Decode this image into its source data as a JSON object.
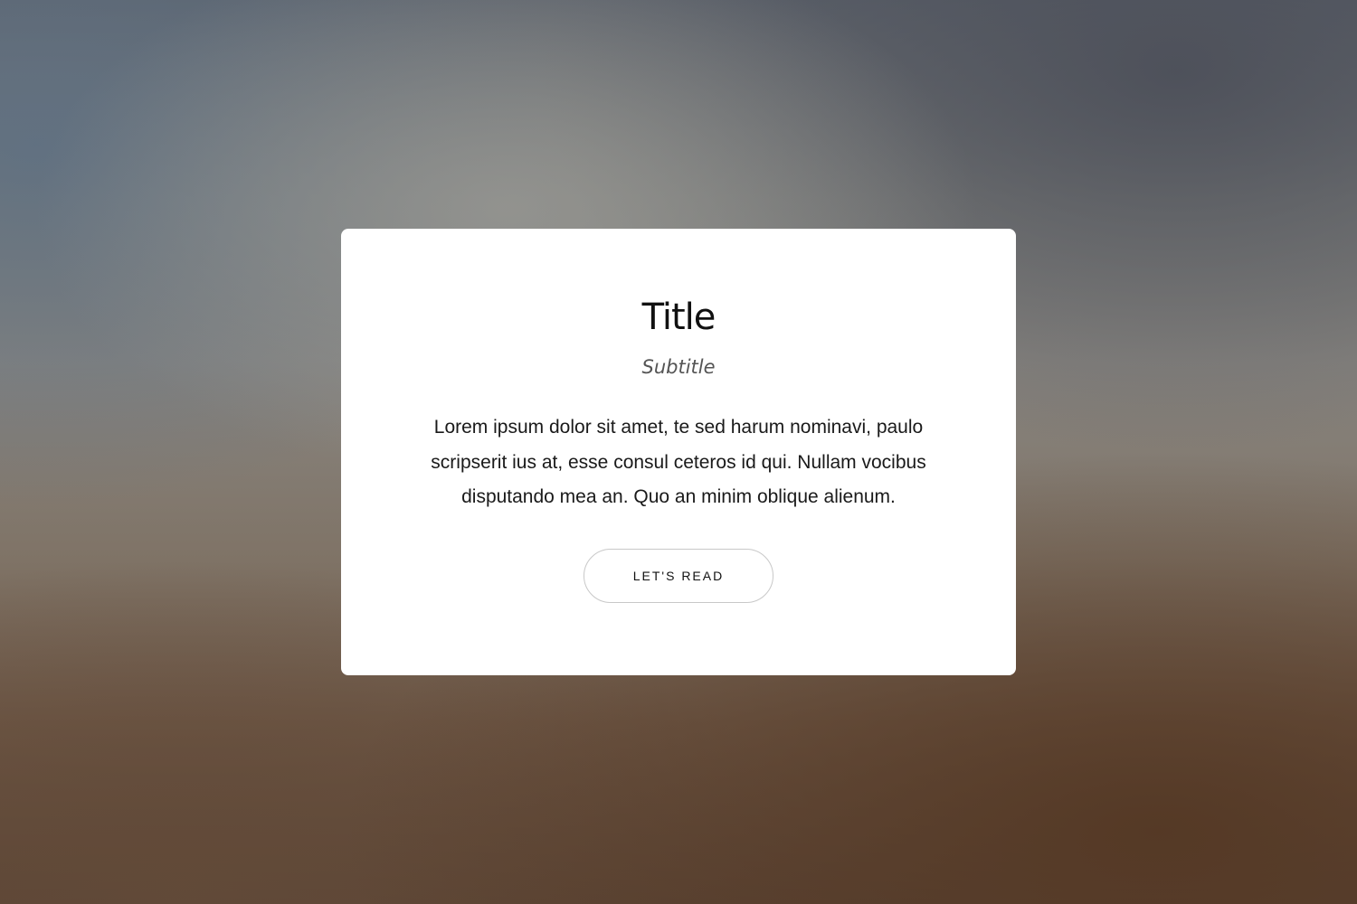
{
  "card": {
    "title": "Title",
    "subtitle": "Subtitle",
    "body": "Lorem ipsum dolor sit amet, te sed harum nominavi, paulo scripserit ius at, esse consul ceteros id qui. Nullam vocibus disputando mea an. Quo an minim oblique alienum.",
    "button_label": "LET'S READ"
  },
  "colors": {
    "card_background": "#ffffff",
    "button_border": "#c8c8c8",
    "text": "#111111"
  }
}
